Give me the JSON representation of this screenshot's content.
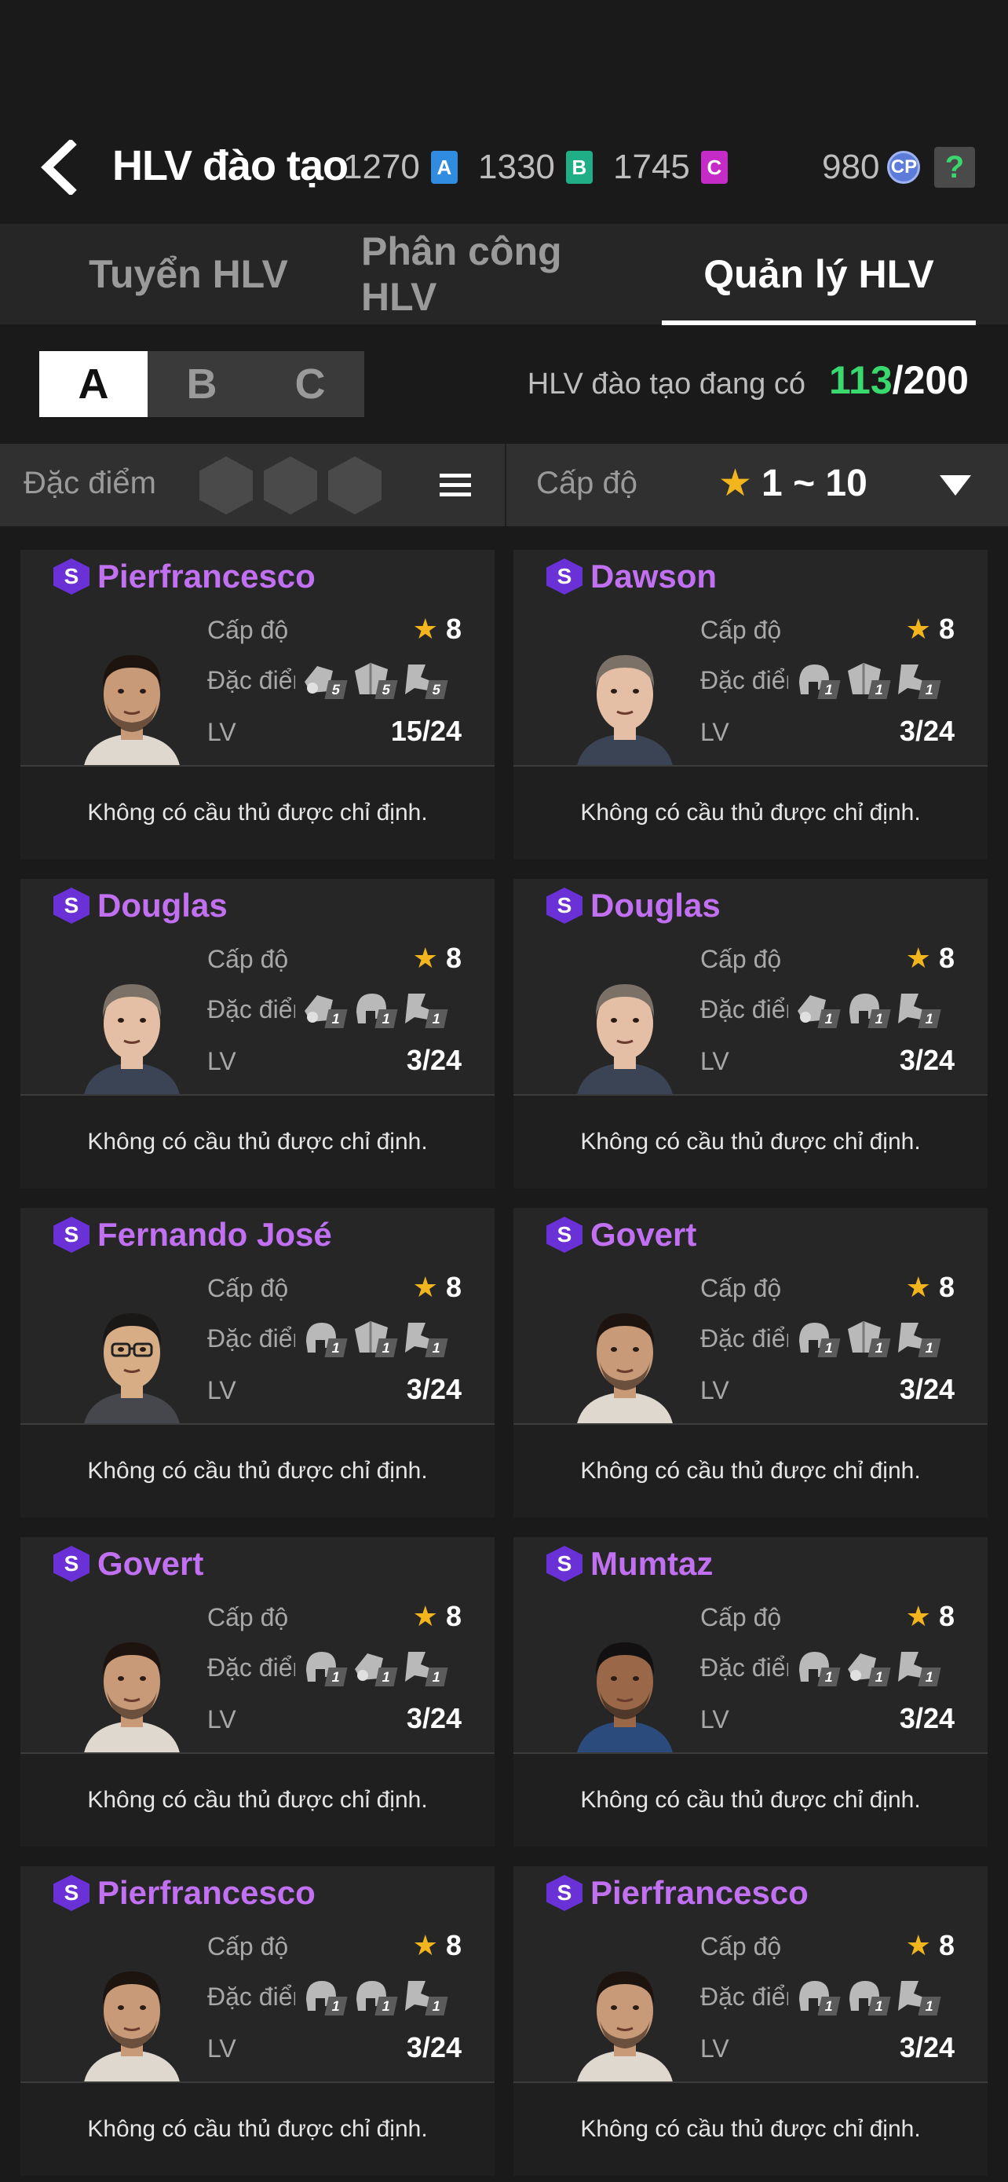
{
  "header": {
    "title": "HLV đào tạo",
    "currencies": [
      {
        "value": "1270",
        "letter": "A",
        "color": "#2f8ce0"
      },
      {
        "value": "1330",
        "letter": "B",
        "color": "#1fae85"
      },
      {
        "value": "1745",
        "letter": "C",
        "color": "#c52cc7"
      }
    ],
    "cp": {
      "value": "980",
      "label": "CP"
    },
    "help_label": "?"
  },
  "tabs": [
    {
      "label": "Tuyển HLV",
      "active": false
    },
    {
      "label": "Phân công  HLV",
      "active": false
    },
    {
      "label": "Quản lý HLV",
      "active": true
    }
  ],
  "groups": [
    {
      "label": "A",
      "active": true
    },
    {
      "label": "B",
      "active": false
    },
    {
      "label": "C",
      "active": false
    }
  ],
  "coach_count": {
    "label": "HLV đào tạo đang có",
    "current": "113",
    "max": "/200"
  },
  "filters": {
    "trait_label": "Đặc điểm đ",
    "level_label": "Cấp độ",
    "level_star": "★",
    "level_range": "1 ~ 10"
  },
  "card_labels": {
    "level": "Cấp độ",
    "traits": "Đặc điểm",
    "lv": "LV",
    "star": "★",
    "footer": "Không có cầu thủ được chỉ định.",
    "badge": "S"
  },
  "coaches": [
    {
      "name": "Pierfrancesco",
      "level": "8",
      "lv": "15/24",
      "traits": [
        {
          "icon": "dribble-trait-icon",
          "value": "5"
        },
        {
          "icon": "shield-trait-icon",
          "value": "5"
        },
        {
          "icon": "kick-trait-icon",
          "value": "5"
        }
      ],
      "face": "tan"
    },
    {
      "name": "Dawson",
      "level": "8",
      "lv": "3/24",
      "traits": [
        {
          "icon": "helmet-trait-icon",
          "value": "1"
        },
        {
          "icon": "shield-trait-icon",
          "value": "1"
        },
        {
          "icon": "kick-trait-icon",
          "value": "1"
        }
      ],
      "face": "light"
    },
    {
      "name": "Douglas",
      "level": "8",
      "lv": "3/24",
      "traits": [
        {
          "icon": "dribble-trait-icon",
          "value": "1"
        },
        {
          "icon": "helmet-trait-icon",
          "value": "1"
        },
        {
          "icon": "kick-trait-icon",
          "value": "1"
        }
      ],
      "face": "light"
    },
    {
      "name": "Douglas",
      "level": "8",
      "lv": "3/24",
      "traits": [
        {
          "icon": "dribble-trait-icon",
          "value": "1"
        },
        {
          "icon": "helmet-trait-icon",
          "value": "1"
        },
        {
          "icon": "kick-trait-icon",
          "value": "1"
        }
      ],
      "face": "light"
    },
    {
      "name": "Fernando José",
      "level": "8",
      "lv": "3/24",
      "traits": [
        {
          "icon": "helmet-trait-icon",
          "value": "1"
        },
        {
          "icon": "shield-trait-icon",
          "value": "1"
        },
        {
          "icon": "kick-trait-icon",
          "value": "1"
        }
      ],
      "face": "glasses"
    },
    {
      "name": "Govert",
      "level": "8",
      "lv": "3/24",
      "traits": [
        {
          "icon": "helmet-trait-icon",
          "value": "1"
        },
        {
          "icon": "shield-trait-icon",
          "value": "1"
        },
        {
          "icon": "kick-trait-icon",
          "value": "1"
        }
      ],
      "face": "tan"
    },
    {
      "name": "Govert",
      "level": "8",
      "lv": "3/24",
      "traits": [
        {
          "icon": "helmet-trait-icon",
          "value": "1"
        },
        {
          "icon": "dribble-trait-icon",
          "value": "1"
        },
        {
          "icon": "kick-trait-icon",
          "value": "1"
        }
      ],
      "face": "tan"
    },
    {
      "name": "Mumtaz",
      "level": "8",
      "lv": "3/24",
      "traits": [
        {
          "icon": "helmet-trait-icon",
          "value": "1"
        },
        {
          "icon": "dribble-trait-icon",
          "value": "1"
        },
        {
          "icon": "kick-trait-icon",
          "value": "1"
        }
      ],
      "face": "dark"
    },
    {
      "name": "Pierfrancesco",
      "level": "8",
      "lv": "3/24",
      "traits": [
        {
          "icon": "helmet-trait-icon",
          "value": "1"
        },
        {
          "icon": "helmet-trait-icon",
          "value": "1"
        },
        {
          "icon": "kick-trait-icon",
          "value": "1"
        }
      ],
      "face": "tan"
    },
    {
      "name": "Pierfrancesco",
      "level": "8",
      "lv": "3/24",
      "traits": [
        {
          "icon": "helmet-trait-icon",
          "value": "1"
        },
        {
          "icon": "helmet-trait-icon",
          "value": "1"
        },
        {
          "icon": "kick-trait-icon",
          "value": "1"
        }
      ],
      "face": "tan"
    }
  ]
}
